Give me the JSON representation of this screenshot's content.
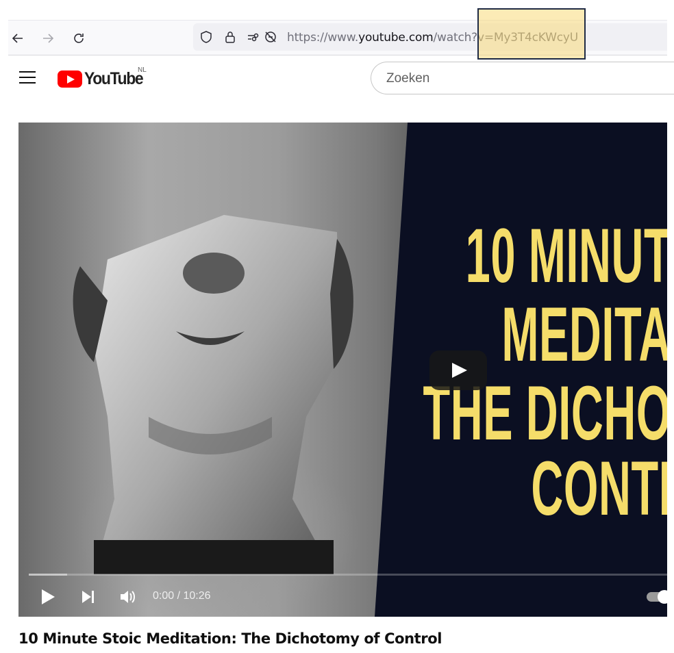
{
  "browser": {
    "url_prefix": "https://www.",
    "url_domain": "youtube.com",
    "url_path": "/watch?v=My3T4cKWcyU",
    "icons": [
      "back-arrow-icon",
      "forward-arrow-icon",
      "reload-icon",
      "shield-icon",
      "lock-icon",
      "permissions-icon",
      "no-tracking-icon"
    ]
  },
  "youtube": {
    "logo_text": "YouTube",
    "region_code": "NL",
    "search_placeholder": "Zoeken"
  },
  "video": {
    "thumbnail_title_lines": [
      "10 MINUT",
      "MEDITA",
      "THE DICHO",
      "CONTI"
    ],
    "current_time": "0:00",
    "separator": " / ",
    "duration": "10:26",
    "progress_fraction": 0.0,
    "buffered_fraction": 0.06,
    "title": "10 Minute Stoic Meditation: The Dichotomy of Control"
  },
  "colors": {
    "youtube_red": "#ff0000",
    "thumbnail_text": "#f5dd6a",
    "thumbnail_bg": "#0b0f22",
    "highlight": "#fad76e"
  }
}
